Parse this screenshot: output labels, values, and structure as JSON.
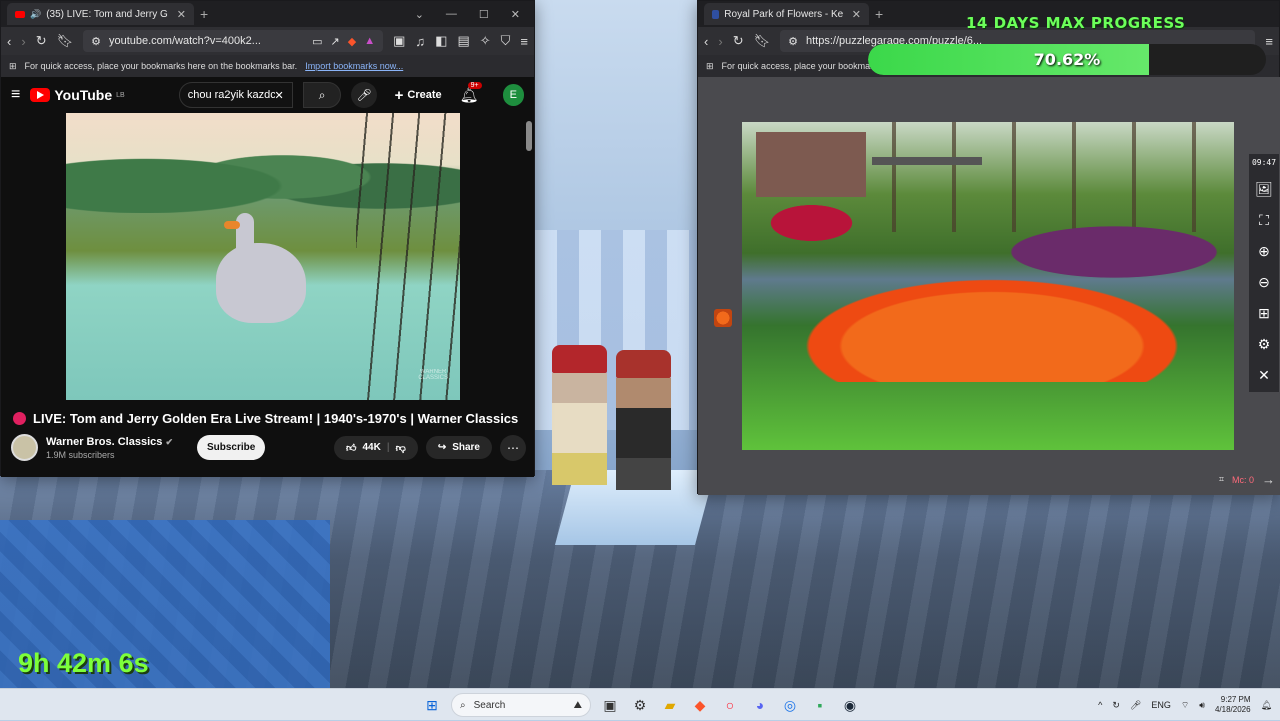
{
  "colors": {
    "youtube_red": "#ff0000",
    "progress_green": "#3bd84a",
    "timer_green": "#7dff3a",
    "live_dot": "#e02060"
  },
  "youtube_window": {
    "tab": {
      "favicon": "youtube-icon",
      "title": "(35) LIVE: Tom and Jerry G",
      "close": "✕"
    },
    "window_controls": {
      "dropdown": "⌄",
      "minimize": "—",
      "maximize": "☐",
      "close": "✕"
    },
    "toolbar": {
      "url": "youtube.com/watch?v=400k2..."
    },
    "bookmarks_bar": {
      "text": "For quick access, place your bookmarks here on the bookmarks bar.",
      "link": "Import bookmarks now..."
    },
    "header": {
      "logo_text": "YouTube",
      "logo_region": "LB",
      "search_value": "chou ra2yik kazdc",
      "create_label": "Create",
      "notifications_badge": "9+",
      "avatar_letter": "E"
    },
    "video": {
      "watermark_line1": "WARNER",
      "watermark_line2": "CLASSICS"
    },
    "title": "LIVE: Tom and Jerry Golden Era Live Stream! | 1940's-1970's | Warner Classics",
    "channel": {
      "name": "Warner Bros. Classics",
      "verified": "✔",
      "subscribers": "1.9M subscribers",
      "subscribe_label": "Subscribe"
    },
    "actions": {
      "likes": "44K",
      "share_label": "Share",
      "more": "⋯"
    }
  },
  "puzzle_window": {
    "tab": {
      "title": "Royal Park of Flowers - Keukenh",
      "close": "✕"
    },
    "toolbar": {
      "url": "https://puzzlegarage.com/puzzle/6..."
    },
    "bookmarks_bar": {
      "text": "For quick access, place your bookmark"
    },
    "side_tools": {
      "time": "09:47"
    },
    "footer": {
      "label": "Mc: 0"
    }
  },
  "overlay": {
    "progress_title": "14 DAYS MAX PROGRESS",
    "progress_text": "70.62%",
    "progress_value": 70.62,
    "stream_timer": "9h 42m 6s"
  },
  "taskbar": {
    "search_placeholder": "Search",
    "language": "ENG",
    "time": "9:27 PM",
    "date": "4/18/2026",
    "pinned_icons": [
      "windows-start-icon",
      "search-icon",
      "widget-icon",
      "task-view-icon",
      "settings-icon",
      "file-explorer-icon",
      "brave-icon",
      "opera-icon",
      "discord-icon",
      "chrome-icon",
      "app-icon",
      "steam-icon"
    ]
  }
}
